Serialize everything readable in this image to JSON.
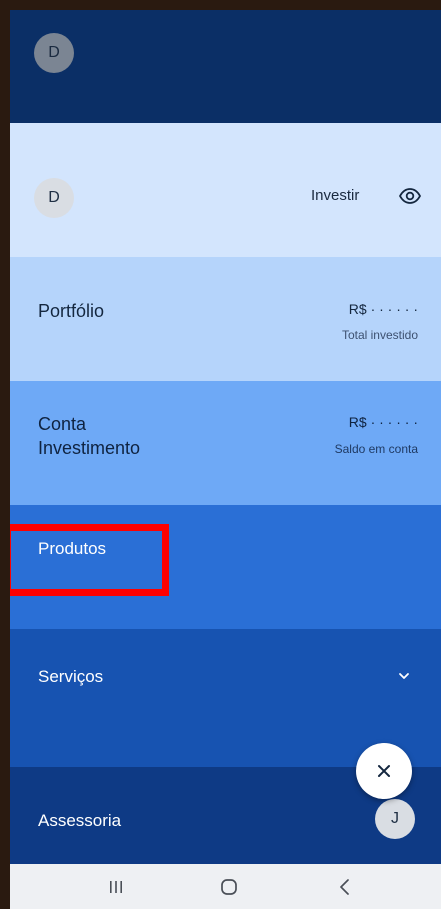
{
  "top": {
    "avatar_initial": "D"
  },
  "investir": {
    "avatar_initial": "D",
    "label": "Investir",
    "icon": "eye-icon"
  },
  "portfolio": {
    "title": "Portfólio",
    "amount": "R$ · · · · · ·",
    "caption": "Total investido"
  },
  "conta": {
    "title_line1": "Conta",
    "title_line2": "Investimento",
    "amount": "R$ · · · · · ·",
    "caption": "Saldo em conta"
  },
  "produtos": {
    "title": "Produtos"
  },
  "servicos": {
    "title": "Serviços",
    "icon": "chevron-down-icon"
  },
  "assessoria": {
    "title": "Assessoria",
    "avatar_initial": "J"
  },
  "fab": {
    "label": "×",
    "icon": "close-icon"
  },
  "navbar": {
    "recents_icon": "recents-icon",
    "home_icon": "home-icon",
    "back_icon": "back-icon"
  },
  "colors": {
    "top": "#0b2f66",
    "investir": "#d3e5fd",
    "portfolio": "#b5d4fb",
    "conta": "#6ea9f6",
    "produtos": "#2a6fd6",
    "servicos": "#1753b1",
    "assessoria": "#0e3a85",
    "highlight": "#ff0000"
  }
}
